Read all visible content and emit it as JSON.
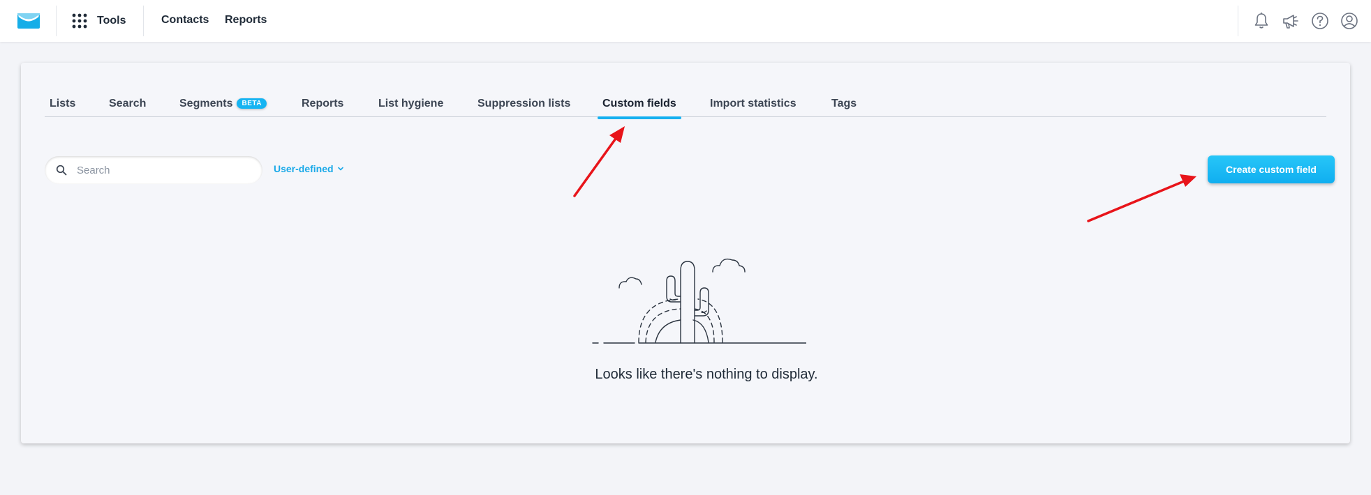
{
  "topbar": {
    "tools_label": "Tools",
    "nav": [
      {
        "label": "Contacts"
      },
      {
        "label": "Reports"
      }
    ],
    "icons": [
      "bell-icon",
      "megaphone-icon",
      "help-icon",
      "user-account-icon"
    ]
  },
  "tabs": [
    {
      "label": "Lists"
    },
    {
      "label": "Search"
    },
    {
      "label": "Segments",
      "badge": "BETA"
    },
    {
      "label": "Reports"
    },
    {
      "label": "List hygiene"
    },
    {
      "label": "Suppression lists"
    },
    {
      "label": "Custom fields",
      "active": true
    },
    {
      "label": "Import statistics"
    },
    {
      "label": "Tags"
    }
  ],
  "search": {
    "placeholder": "Search",
    "value": ""
  },
  "filter": {
    "label": "User-defined"
  },
  "create_button": {
    "label": "Create custom field"
  },
  "empty_state": {
    "message": "Looks like there's nothing to display."
  },
  "colors": {
    "accent": "#16b4f2",
    "annotation_arrow": "#e8141a",
    "text": "#1f2a37"
  }
}
